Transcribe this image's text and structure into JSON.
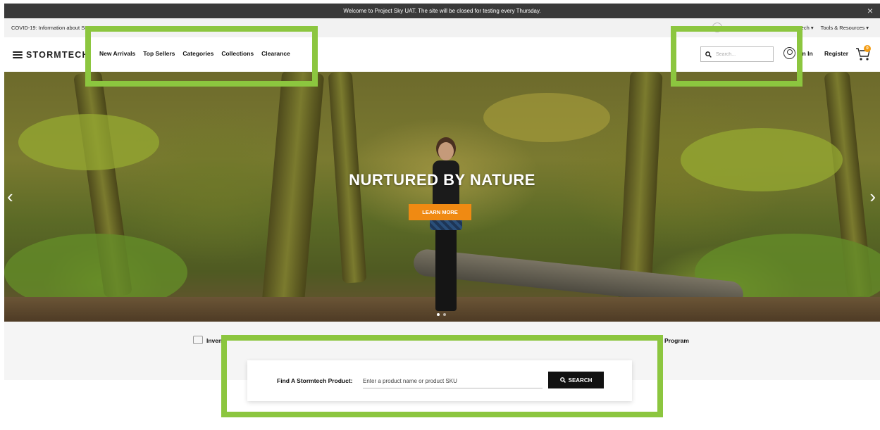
{
  "announcement": {
    "text": "Welcome to Project Sky UAT. The site will be closed for testing every Thursday.",
    "close": "×"
  },
  "utility": {
    "covid_link": "COVID-19: Information about Stor",
    "right_links": [
      "ech ▾",
      "Tools & Resources ▾"
    ]
  },
  "header": {
    "logo_text": "STORMTECH",
    "nav": [
      "New Arrivals",
      "Top Sellers",
      "Categories",
      "Collections",
      "Clearance"
    ],
    "search_placeholder": "Search...",
    "sign_in": "ign In",
    "register": "Register",
    "cart_count": "0"
  },
  "hero": {
    "title": "NURTURED BY NATURE",
    "cta": "LEARN MORE",
    "prev": "‹",
    "next": "›"
  },
  "features": {
    "item_1": "Inven",
    "item_5": "Program"
  },
  "finder": {
    "label": "Find A Stormtech Product:",
    "placeholder": "Enter a product name or product SKU",
    "button": "SEARCH"
  },
  "colors": {
    "highlight": "#8cc63f",
    "cta": "#f08a12",
    "badge": "#f39c12"
  }
}
